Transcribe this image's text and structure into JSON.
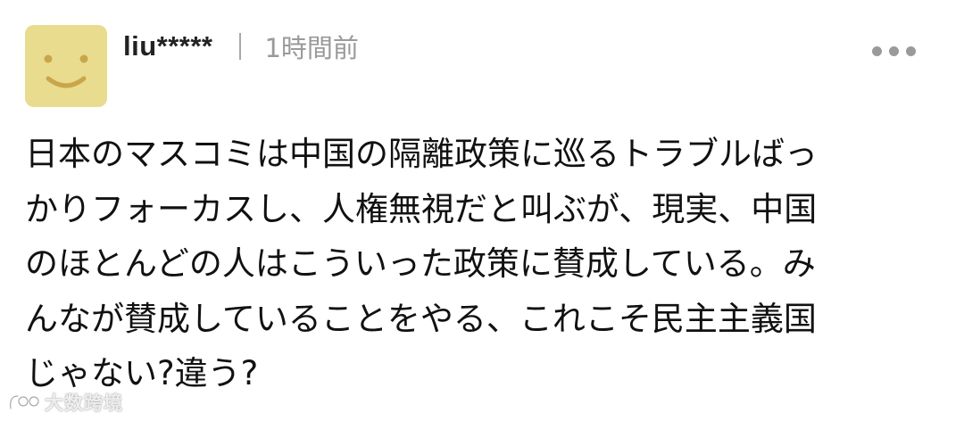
{
  "comment": {
    "author": {
      "username": "liu*****",
      "avatar_color": "#e9dc8f",
      "avatar_icon": "smiley-face-icon"
    },
    "separator": "|",
    "timestamp": "1時間前",
    "more_icon": "more-dots-icon",
    "body_lines": [
      "日本のマスコミは中国の隔離政策に巡るトラブルばっ",
      "かりフォーカスし、人権無視だと叫ぶが、現実、中国",
      "のほとんどの人はこういった政策に賛成している。み",
      "んなが賛成していることをやる、これこそ民主主義国",
      "じゃない?違う?"
    ]
  },
  "watermark": {
    "text": "大数跨境",
    "logo_icon": "watermark-logo-icon"
  }
}
